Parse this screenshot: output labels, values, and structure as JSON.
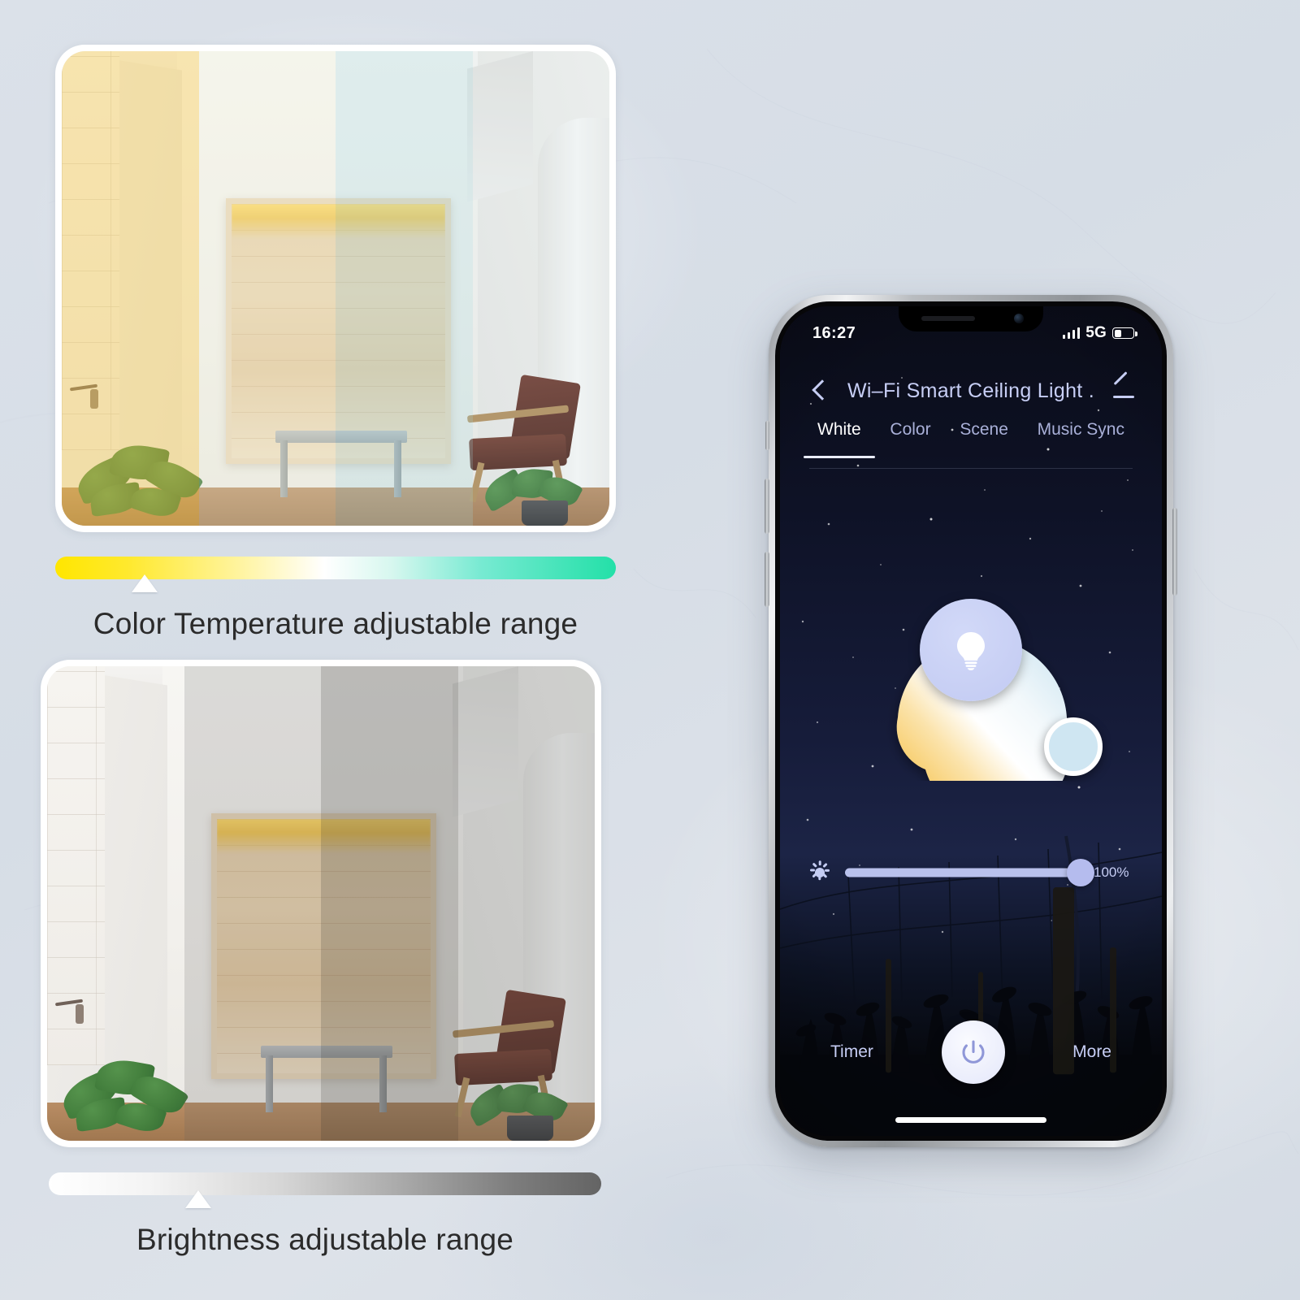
{
  "background": {
    "color": "#d8dee6"
  },
  "left_panel": {
    "color_temperature": {
      "photo_alt": "Interior room with color temperature zones",
      "scale_label": "Color Temperature adjustable range",
      "marker_percent": 16,
      "gradient": [
        "#ffe600",
        "#ffffff",
        "#23e0a8"
      ],
      "zones": [
        {
          "name": "warm",
          "overlay": "rgba(247,204,84,0.42)"
        },
        {
          "name": "neutral",
          "overlay": "rgba(238,241,220,0.30)"
        },
        {
          "name": "cool",
          "overlay": "rgba(176,219,226,0.34)"
        },
        {
          "name": "coolest",
          "overlay": "rgba(196,226,231,0.16)"
        }
      ]
    },
    "brightness": {
      "photo_alt": "Interior room with brightness zones",
      "scale_label": "Brightness adjustable range",
      "marker_percent": 27,
      "gradient": [
        "#ffffff",
        "#646464"
      ],
      "zones": [
        {
          "name": "bright",
          "overlay": "rgba(255,255,255,0.04)"
        },
        {
          "name": "medium",
          "overlay": "rgba(120,120,118,0.22)"
        },
        {
          "name": "dim",
          "overlay": "rgba(80,80,78,0.36)"
        },
        {
          "name": "dark",
          "overlay": "rgba(110,112,112,0.26)"
        }
      ]
    }
  },
  "phone": {
    "status_bar": {
      "time": "16:27",
      "network": "5G",
      "signal_icon": "signal-bars-icon",
      "battery_icon": "battery-icon",
      "battery_level_percent": 32
    },
    "nav": {
      "back_icon": "chevron-left-icon",
      "title": "Wi–Fi Smart Ceiling Light .",
      "edit_icon": "pencil-icon"
    },
    "tabs": [
      {
        "label": "White",
        "active": true
      },
      {
        "label": "Color",
        "active": false
      },
      {
        "label": "Scene",
        "active": false
      },
      {
        "label": "Music Sync",
        "active": false
      }
    ],
    "dial": {
      "name": "color-temperature-dial",
      "center_icon": "light-bulb-icon",
      "arc_colors": [
        "#f6c459",
        "#ffffff",
        "#cfe6f2"
      ],
      "thumb_color": "#cfe6f2",
      "center_color": "#c5cdf2"
    },
    "brightness_slider": {
      "icon": "brightness-sun-icon",
      "value": "100%",
      "value_percent": 100,
      "accent": "#b5bcee"
    },
    "bottom_bar": {
      "timer_label": "Timer",
      "power_icon": "power-icon",
      "more_label": "More"
    },
    "home_indicator": "home-indicator"
  }
}
